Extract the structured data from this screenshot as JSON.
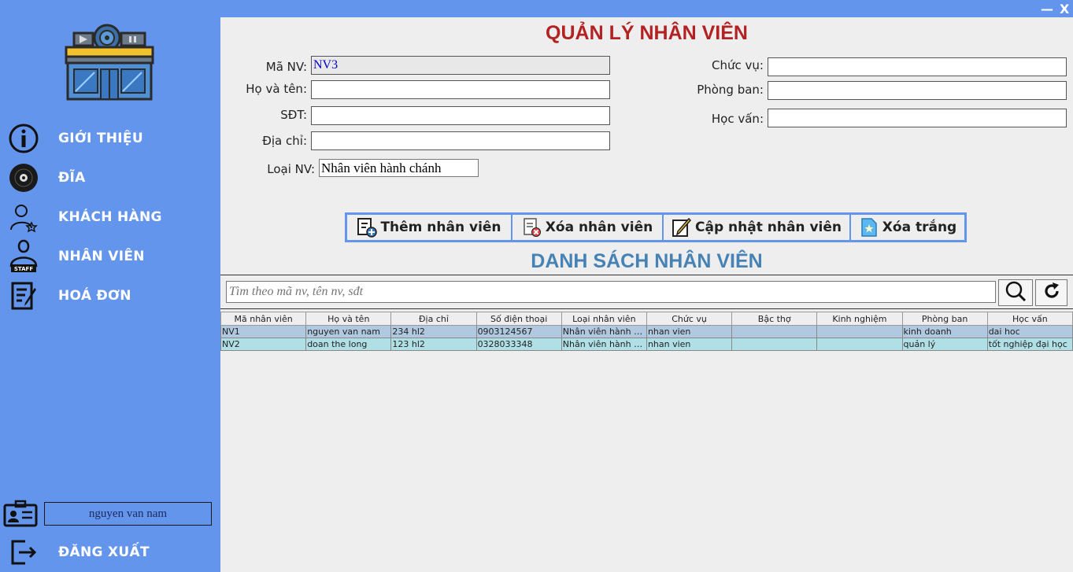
{
  "window": {
    "minimize": "—",
    "close": "X"
  },
  "sidebar": {
    "items": [
      {
        "label": "GIỚI THIỆU",
        "icon": "info-icon"
      },
      {
        "label": "ĐĨA",
        "icon": "disc-icon"
      },
      {
        "label": "KHÁCH HÀNG",
        "icon": "customer-icon"
      },
      {
        "label": "NHÂN VIÊN",
        "icon": "staff-icon"
      },
      {
        "label": "HOÁ ĐƠN",
        "icon": "invoice-icon"
      }
    ],
    "user_name": "nguyen van nam",
    "logout_label": "ĐĂNG XUẤT"
  },
  "form": {
    "title": "QUẢN LÝ NHÂN VIÊN",
    "ma_nv_label": "Mã NV:",
    "ma_nv_value": "NV3",
    "ho_ten_label": "Họ và tên:",
    "ho_ten_value": "",
    "sdt_label": "SĐT:",
    "sdt_value": "",
    "dia_chi_label": "Địa chỉ:",
    "dia_chi_value": "",
    "loai_nv_label": "Loại NV:",
    "loai_nv_value": "Nhân viên hành chánh",
    "chuc_vu_label": "Chức vụ:",
    "chuc_vu_value": "",
    "phong_ban_label": "Phòng ban:",
    "phong_ban_value": "",
    "hoc_van_label": "Học vấn:",
    "hoc_van_value": ""
  },
  "toolbar": {
    "add_label": "Thêm nhân viên",
    "delete_label": "Xóa nhân viên",
    "update_label": "Cập nhật nhân viên",
    "clear_label": "Xóa trắng"
  },
  "list": {
    "title": "DANH SÁCH NHÂN VIÊN",
    "search_placeholder": "Tìm theo mã nv, tên nv, sđt"
  },
  "table": {
    "columns": [
      "Mã nhân viên",
      "Họ và tên",
      "Địa chỉ",
      "Số điện thoại",
      "Loại nhân viên",
      "Chức vụ",
      "Bậc thợ",
      "Kinh nghiệm",
      "Phòng ban",
      "Học vấn"
    ],
    "rows": [
      [
        "NV1",
        "nguyen van nam",
        "234 hl2",
        "0903124567",
        "Nhân viên hành c...",
        "nhan vien",
        "",
        "",
        "kinh doanh",
        "dai hoc"
      ],
      [
        "NV2",
        "doan the long",
        "123 hl2",
        "0328033348",
        "Nhân viên hành c...",
        "nhan vien",
        "",
        "",
        "quản lý",
        "tốt nghiệp đại học"
      ]
    ]
  }
}
